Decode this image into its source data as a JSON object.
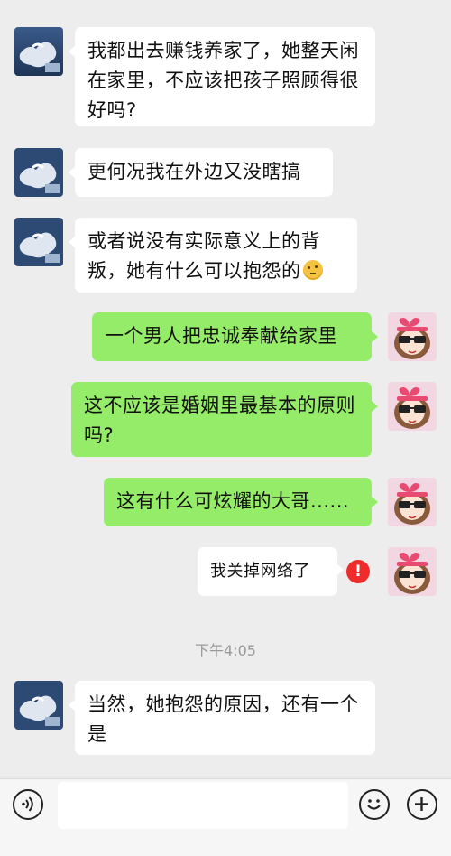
{
  "messages": [
    {
      "side": "left",
      "text": "我都出去赚钱养家了，她整天闲在家里，不应该把孩子照顾得很好吗?"
    },
    {
      "side": "left",
      "text": "更何况我在外边又没瞎搞"
    },
    {
      "side": "left",
      "text": "或者说没有实际意义上的背叛，她有什么可以抱怨的",
      "emoji": "thinking-face"
    },
    {
      "side": "right",
      "text": "一个男人把忠诚奉献给家里"
    },
    {
      "side": "right",
      "text": "这不应该是婚姻里最基本的原则吗?"
    },
    {
      "side": "right",
      "text": "这有什么可炫耀的大哥......"
    },
    {
      "side": "right",
      "text": "我关掉网络了",
      "status": "failed"
    },
    {
      "side": "left",
      "text": "当然，她抱怨的原因，还有一个是"
    }
  ],
  "timestamp": "下午4:05",
  "error_badge": "!",
  "colors": {
    "background": "#ededed",
    "incoming_bubble": "#ffffff",
    "outgoing_bubble": "#95ec69",
    "error": "#f02b2b"
  },
  "input_bar": {
    "voice_icon": "voice-icon",
    "emoji_icon": "emoji-icon",
    "add_icon": "plus-icon",
    "input_value": ""
  }
}
